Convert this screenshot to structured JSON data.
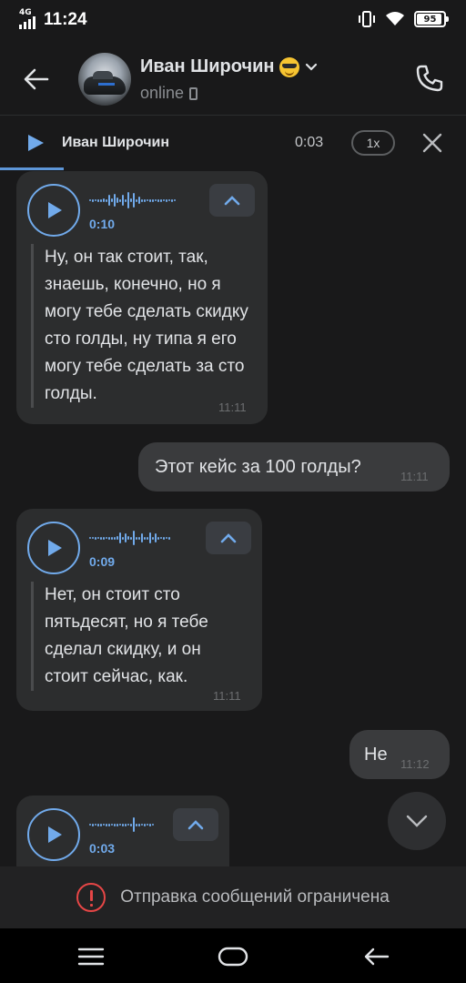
{
  "status_bar": {
    "network": "4G",
    "time": "11:24",
    "battery": "95"
  },
  "header": {
    "peer_name": "Иван Широчин",
    "status": "online"
  },
  "player": {
    "author": "Иван Широчин",
    "time": "0:03",
    "speed": "1x"
  },
  "messages": [
    {
      "type": "voice",
      "direction": "in",
      "duration": "0:10",
      "transcript": "Ну, он так стоит, так, знаешь, конечно, но я могу тебе сделать скидку сто голды, ну типа я его могу тебе сделать за сто голды.",
      "time": "11:11"
    },
    {
      "type": "text",
      "direction": "out",
      "text": "Этот кейс за 100 голды?",
      "time": "11:11"
    },
    {
      "type": "voice",
      "direction": "in",
      "duration": "0:09",
      "transcript": "Нет, он стоит сто пятьдесят, но я тебе сделал скидку, и он стоит сейчас, как.",
      "time": "11:11"
    },
    {
      "type": "text",
      "direction": "out",
      "text": "Не",
      "time": "11:12"
    },
    {
      "type": "voice",
      "direction": "in",
      "duration": "0:03"
    }
  ],
  "composer": {
    "restricted_text": "Отправка сообщений ограничена"
  },
  "colors": {
    "background": "#19191a",
    "accent": "#71aaeb",
    "bubble_in": "#2c2d2e",
    "bubble_out": "#3a3b3d",
    "warning": "#e64646"
  },
  "icons": [
    "back-arrow-icon",
    "phone-call-icon",
    "play-icon",
    "close-icon",
    "chevron-up-icon",
    "chevron-down-icon",
    "warning-icon",
    "menu-icon",
    "home-icon",
    "nav-back-icon"
  ]
}
